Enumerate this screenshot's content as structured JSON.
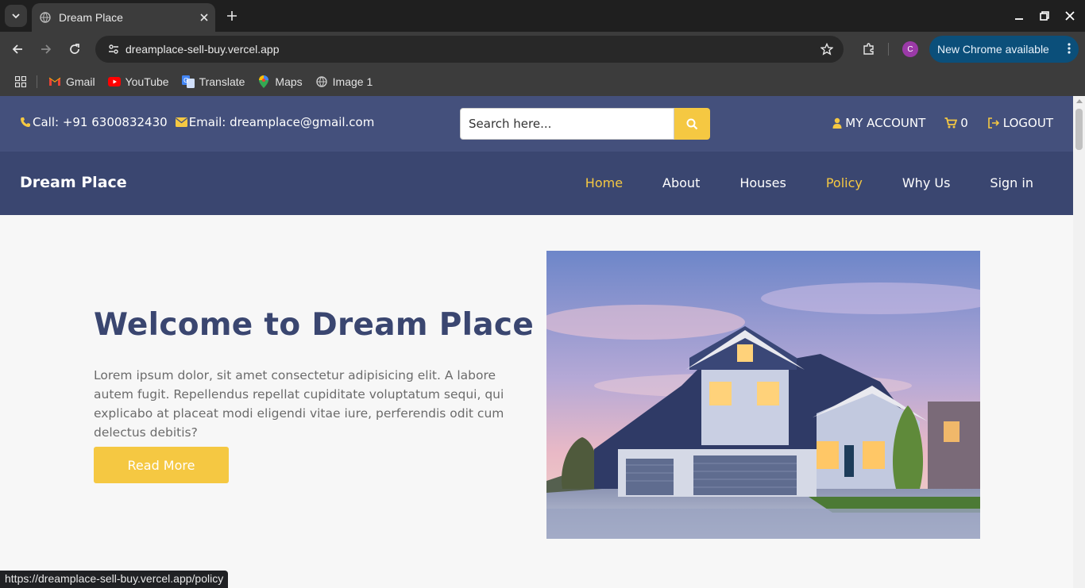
{
  "browser": {
    "tab_title": "Dream Place",
    "url": "dreamplace-sell-buy.vercel.app",
    "update_label": "New Chrome available",
    "profile_initial": "C",
    "bookmarks": [
      {
        "label": "Gmail",
        "icon": "gmail-icon"
      },
      {
        "label": "YouTube",
        "icon": "youtube-icon"
      },
      {
        "label": "Translate",
        "icon": "translate-icon"
      },
      {
        "label": "Maps",
        "icon": "maps-icon"
      },
      {
        "label": "Image 1",
        "icon": "globe-icon"
      }
    ],
    "status_url": "https://dreamplace-sell-buy.vercel.app/policy"
  },
  "topbar": {
    "phone": "Call: +91 6300832430",
    "email": "Email: dreamplace@gmail.com",
    "search_placeholder": "Search here...",
    "account": "MY ACCOUNT",
    "cart_count": "0",
    "logout": "LOGOUT"
  },
  "navbar": {
    "brand": "Dream Place",
    "items": [
      {
        "label": "Home",
        "active": true
      },
      {
        "label": "About",
        "active": false
      },
      {
        "label": "Houses",
        "active": false
      },
      {
        "label": "Policy",
        "active": true
      },
      {
        "label": "Why Us",
        "active": false
      },
      {
        "label": "Sign in",
        "active": false
      }
    ]
  },
  "hero": {
    "title": "Welcome to Dream Place",
    "text": "Lorem ipsum dolor, sit amet consectetur adipisicing elit. A labore autem fugit. Repellendus repellat cupiditate voluptatum sequi, qui explicabo at placeat modi eligendi vitae iure, perferendis odit cum delectus debitis?",
    "button": "Read More"
  },
  "colors": {
    "primary": "#3a4670",
    "topbar": "#44507c",
    "accent": "#f5c842"
  }
}
